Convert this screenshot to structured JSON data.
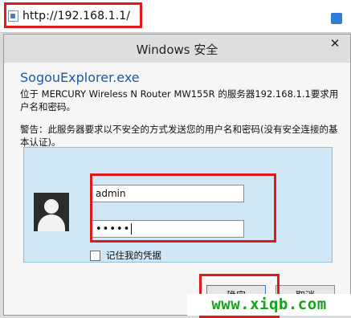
{
  "browser": {
    "address": "http://192.168.1.1/"
  },
  "dialog": {
    "title": "Windows 安全",
    "close_glyph": "✕",
    "app_name": "SogouExplorer.exe",
    "message": "位于 MERCURY Wireless N Router MW155R 的服务器192.168.1.1要求用户名和密码。",
    "warning": "警告：此服务器要求以不安全的方式发送您的用户名和密码(没有安全连接的基本认证)。",
    "username_value": "admin",
    "password_value": "•••••",
    "remember_label": "记住我的凭据",
    "ok_label": "确定",
    "cancel_label": "取消"
  },
  "watermark": "www.xiqb.com",
  "colors": {
    "highlight_boxes": "#e01a1a",
    "app_name": "#1a5aa8",
    "credential_panel": "#cfe7f6",
    "watermark": "#17a31a"
  },
  "icons": {
    "page": "page-icon",
    "avatar": "user-avatar-icon",
    "close": "close-icon"
  }
}
